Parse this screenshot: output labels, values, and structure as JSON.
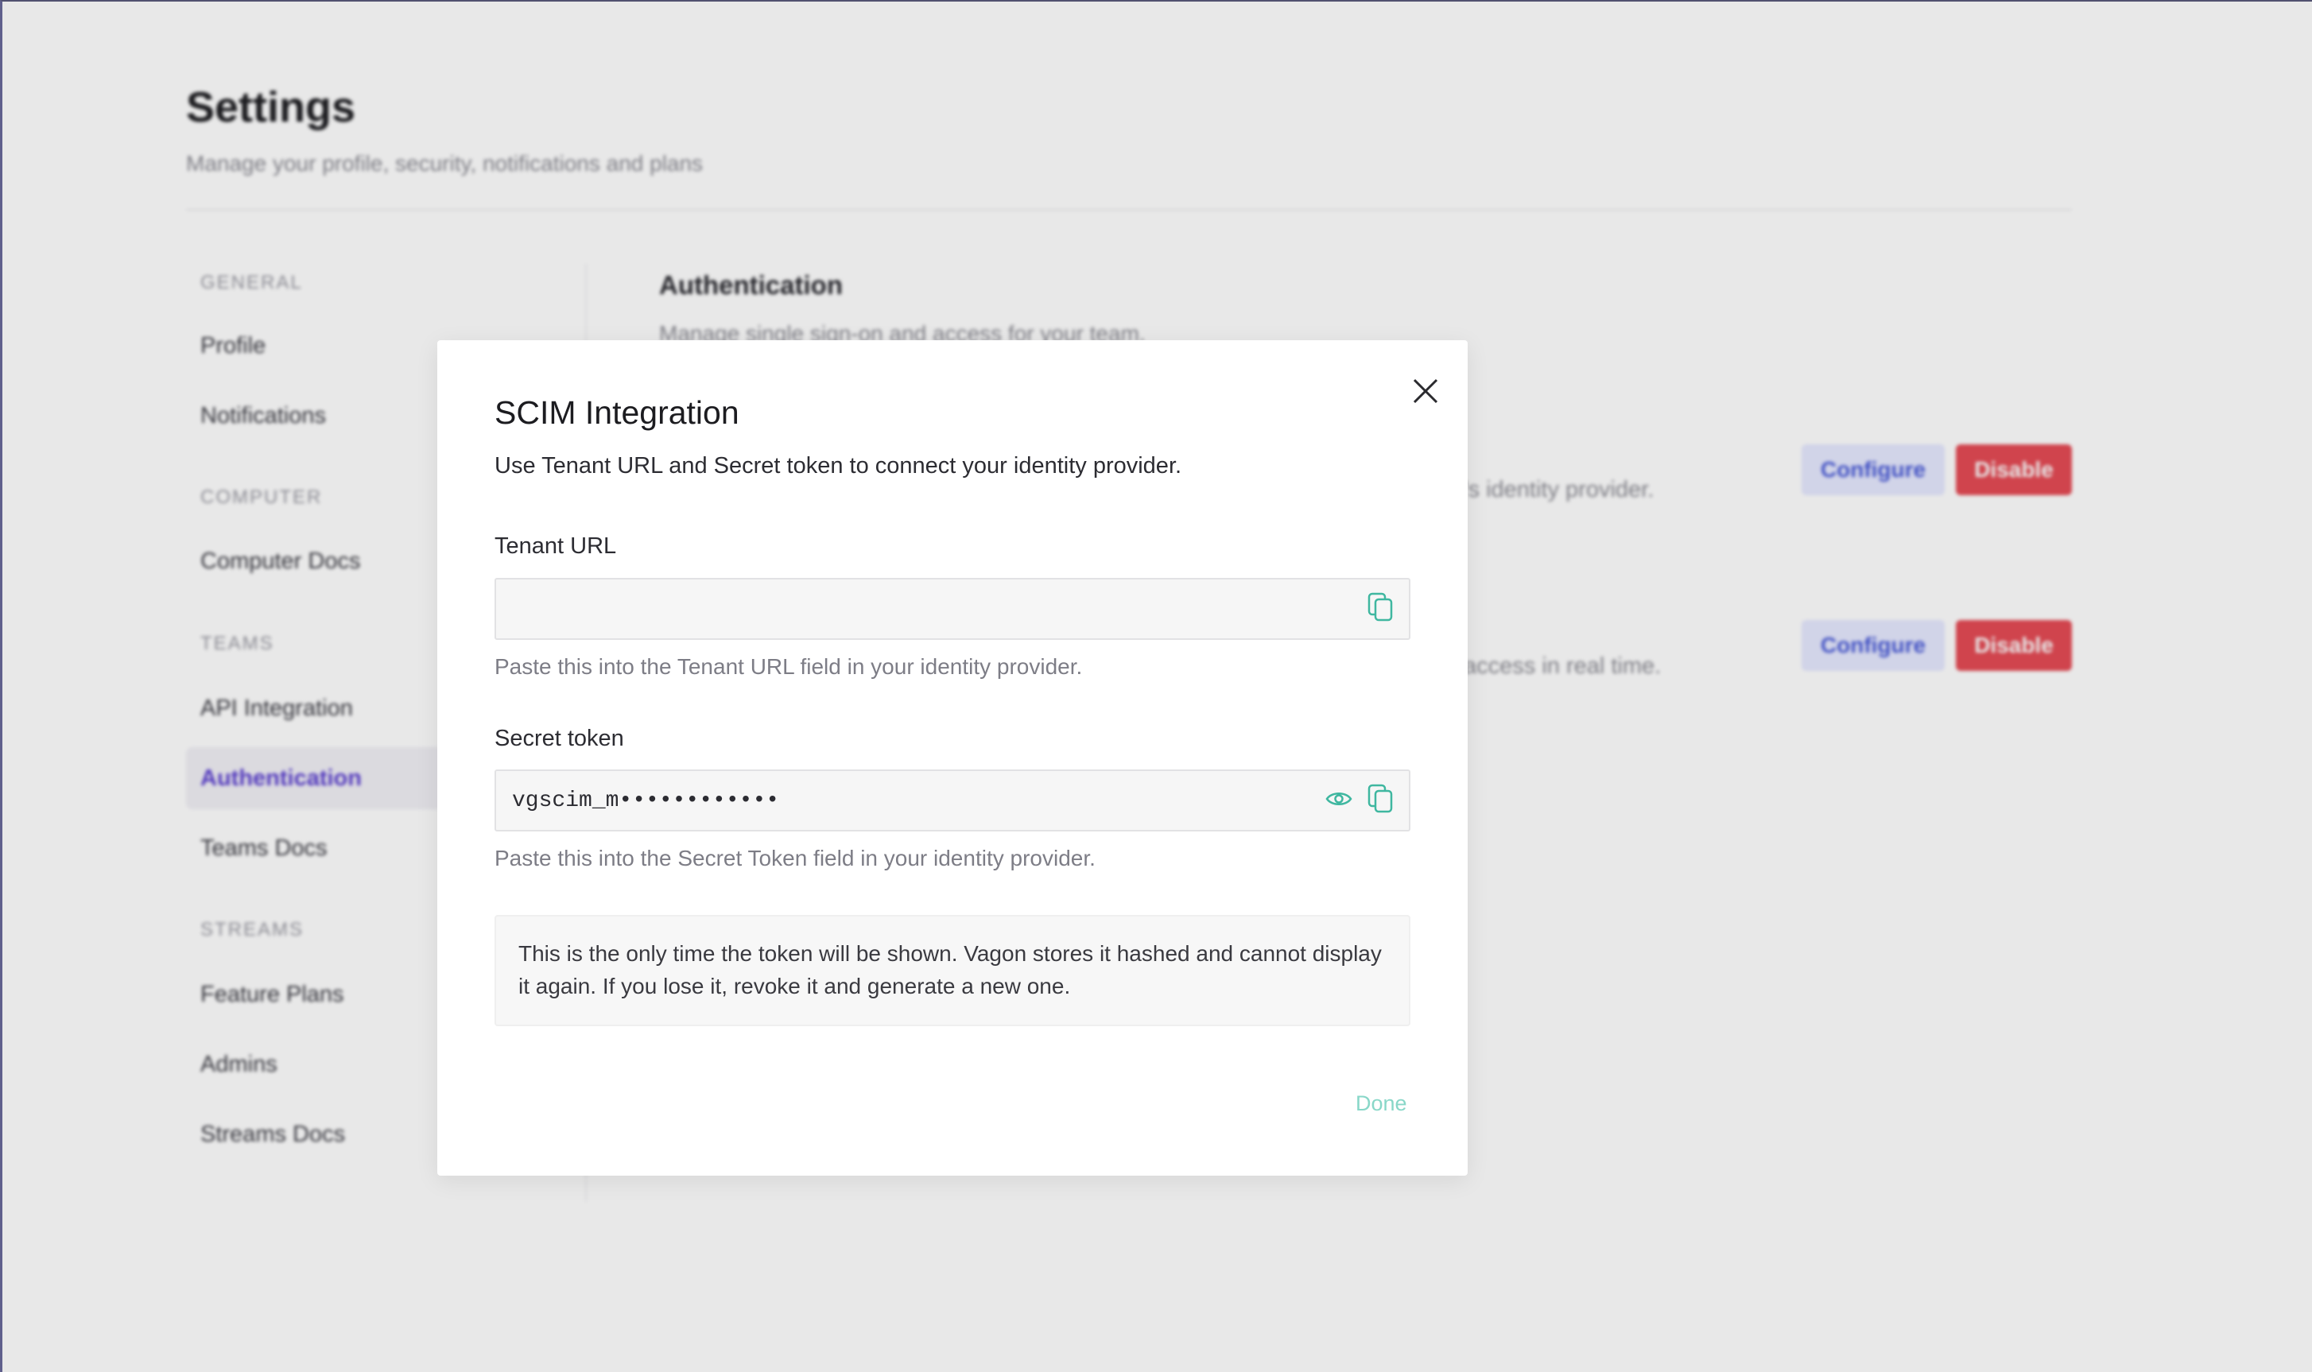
{
  "page": {
    "title": "Settings",
    "subtitle": "Manage your profile, security, notifications and plans"
  },
  "sidebar": {
    "sections": [
      {
        "heading": "GENERAL",
        "items": [
          "Profile",
          "Notifications"
        ]
      },
      {
        "heading": "COMPUTER",
        "items": [
          "Computer Docs"
        ]
      },
      {
        "heading": "TEAMS",
        "items": [
          "API Integration",
          "Authentication",
          "Teams Docs"
        ]
      },
      {
        "heading": "STREAMS",
        "items": [
          "Feature Plans",
          "Admins",
          "Streams Docs"
        ]
      }
    ],
    "active_item": "Authentication"
  },
  "main": {
    "section_title": "Authentication",
    "section_subtitle": "Manage single sign-on and access for your team.",
    "rows": [
      {
        "description_visible": "'s identity provider.",
        "configure_label": "Configure",
        "disable_label": "Disable"
      },
      {
        "description_visible": "access in real time.",
        "configure_label": "Configure",
        "disable_label": "Disable"
      }
    ]
  },
  "modal": {
    "title": "SCIM Integration",
    "description": "Use Tenant URL and Secret token to connect your identity provider.",
    "tenant_url": {
      "label": "Tenant URL",
      "value": "",
      "help": "Paste this into the Tenant URL field in your identity provider."
    },
    "secret_token": {
      "label": "Secret token",
      "value": "vgscim_m••••••••••••",
      "help": "Paste this into the Secret Token field in your identity provider."
    },
    "notice": "This is the only time the token will be shown. Vagon stores it hashed and cannot display it again. If you lose it, revoke it and generate a new one.",
    "done_label": "Done"
  },
  "colors": {
    "accent_purple": "#5b3fd0",
    "configure_bg": "#e6e9ff",
    "disable_bg": "#e54b55",
    "teal_icon": "#3fb7a0",
    "done_text": "#88d7c8"
  },
  "icons": {
    "close": "close-icon",
    "copy": "copy-icon",
    "reveal": "eye-icon"
  }
}
